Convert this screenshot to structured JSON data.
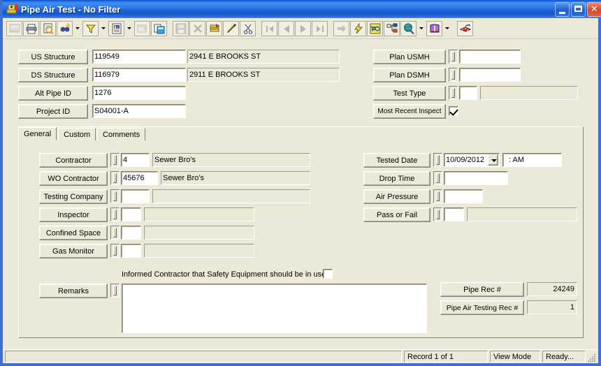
{
  "window": {
    "title": "Pipe Air Test - No Filter",
    "icon": "access-form-icon",
    "buttons": {
      "minimize": "minimize-button",
      "maximize": "maximize-button",
      "close": "close-button"
    }
  },
  "toolbar": {
    "items": [
      {
        "name": "view-design-icon",
        "glyph": "view",
        "enabled": false
      },
      {
        "name": "print-icon",
        "glyph": "print",
        "enabled": true
      },
      {
        "name": "print-preview-icon",
        "glyph": "preview",
        "enabled": true
      },
      {
        "name": "find-icon",
        "glyph": "find",
        "enabled": true
      },
      {
        "name": "find-dropdown-arrow",
        "glyph": "arrow",
        "enabled": true
      },
      {
        "name": "filter-icon",
        "glyph": "filter",
        "enabled": true
      },
      {
        "name": "filter-dropdown-arrow",
        "glyph": "arrow",
        "enabled": true
      },
      {
        "name": "new-object-icon",
        "glyph": "newobj",
        "enabled": true
      },
      {
        "name": "new-object-dropdown-arrow",
        "glyph": "arrow",
        "enabled": true
      },
      {
        "name": "properties-icon",
        "glyph": "props",
        "enabled": false
      },
      {
        "name": "relationships-icon",
        "glyph": "relations",
        "enabled": true
      },
      {
        "name": "separator",
        "glyph": "sep",
        "enabled": true
      },
      {
        "name": "save-icon",
        "glyph": "save",
        "enabled": false
      },
      {
        "name": "delete-record-icon",
        "glyph": "delrec",
        "enabled": false
      },
      {
        "name": "sort-icon",
        "glyph": "sort",
        "enabled": true
      },
      {
        "name": "edit-icon",
        "glyph": "edit",
        "enabled": true
      },
      {
        "name": "cut-icon",
        "glyph": "cut",
        "enabled": true
      },
      {
        "name": "separator",
        "glyph": "sep",
        "enabled": true
      },
      {
        "name": "first-record-icon",
        "glyph": "first",
        "enabled": false
      },
      {
        "name": "previous-record-icon",
        "glyph": "prev",
        "enabled": false
      },
      {
        "name": "next-record-icon",
        "glyph": "next",
        "enabled": false
      },
      {
        "name": "last-record-icon",
        "glyph": "last",
        "enabled": false
      },
      {
        "name": "separator",
        "glyph": "sep",
        "enabled": true
      },
      {
        "name": "goto-record-icon",
        "glyph": "goto",
        "enabled": false
      },
      {
        "name": "lightning-icon",
        "glyph": "bolt",
        "enabled": true
      },
      {
        "name": "map-window-icon",
        "glyph": "mapwin",
        "enabled": true
      },
      {
        "name": "tree-view-icon",
        "glyph": "tree",
        "enabled": true
      },
      {
        "name": "globe-search-icon",
        "glyph": "globe",
        "enabled": true
      },
      {
        "name": "globe-dropdown-arrow",
        "glyph": "arrow",
        "enabled": true
      },
      {
        "name": "help-book-icon",
        "glyph": "book",
        "enabled": true
      },
      {
        "name": "help-dropdown-arrow",
        "glyph": "arrow",
        "enabled": true
      },
      {
        "name": "separator",
        "glyph": "sep",
        "enabled": true
      },
      {
        "name": "export-icon",
        "glyph": "export",
        "enabled": true
      }
    ]
  },
  "header": {
    "left_rows": [
      {
        "label": "US Structure",
        "value": "119549",
        "desc": "2941  E  BROOKS ST"
      },
      {
        "label": "DS Structure",
        "value": "116979",
        "desc": "2911  E BROOKS ST"
      },
      {
        "label": "Alt Pipe ID",
        "value": "1276",
        "desc": ""
      },
      {
        "label": "Project ID",
        "value": "S04001-A",
        "desc": ""
      }
    ],
    "right_rows": [
      {
        "label": "Plan USMH",
        "value": ""
      },
      {
        "label": "Plan DSMH",
        "value": ""
      },
      {
        "label": "Test Type",
        "value": "",
        "desc": ""
      },
      {
        "label": "Most Recent Inspect",
        "value": ""
      }
    ],
    "most_recent_inspect_checked": true
  },
  "tabs": [
    {
      "label": "General",
      "active": true
    },
    {
      "label": "Custom",
      "active": false
    },
    {
      "label": "Comments",
      "active": false
    }
  ],
  "general": {
    "left_rows": [
      {
        "label": "Contractor",
        "code": "4",
        "desc": "Sewer Bro's"
      },
      {
        "label": "WO Contractor",
        "code": "45676",
        "desc": "Sewer Bro's"
      },
      {
        "label": "Testing Company",
        "code": "",
        "desc": ""
      },
      {
        "label": "Inspector",
        "code": "",
        "desc": ""
      },
      {
        "label": "Confined Space",
        "code": "",
        "desc": ""
      },
      {
        "label": "Gas Monitor",
        "code": "",
        "desc": ""
      }
    ],
    "right_rows": [
      {
        "label": "Tested Date",
        "value": "10/09/2012",
        "extra": ":   AM"
      },
      {
        "label": "Drop Time",
        "value": ""
      },
      {
        "label": "Air Pressure",
        "value": ""
      },
      {
        "label": "Pass or Fail",
        "value": "",
        "desc": ""
      }
    ],
    "safety_checkbox_label": "Informed Contractor that Safety Equipment should be in use",
    "safety_checkbox_checked": false,
    "remarks_label": "Remarks",
    "remarks_value": "",
    "rec_rows": [
      {
        "label": "Pipe Rec #",
        "value": "24249"
      },
      {
        "label": "Pipe Air Testing Rec #",
        "value": "1"
      }
    ]
  },
  "statusbar": {
    "record": "Record 1 of 1",
    "mode": "View Mode",
    "state": "Ready..."
  },
  "colors": {
    "face": "#ece9d8",
    "title_blue": "#1e63d6",
    "field_white": "#ffffff",
    "border_shadow": "#84817a"
  }
}
